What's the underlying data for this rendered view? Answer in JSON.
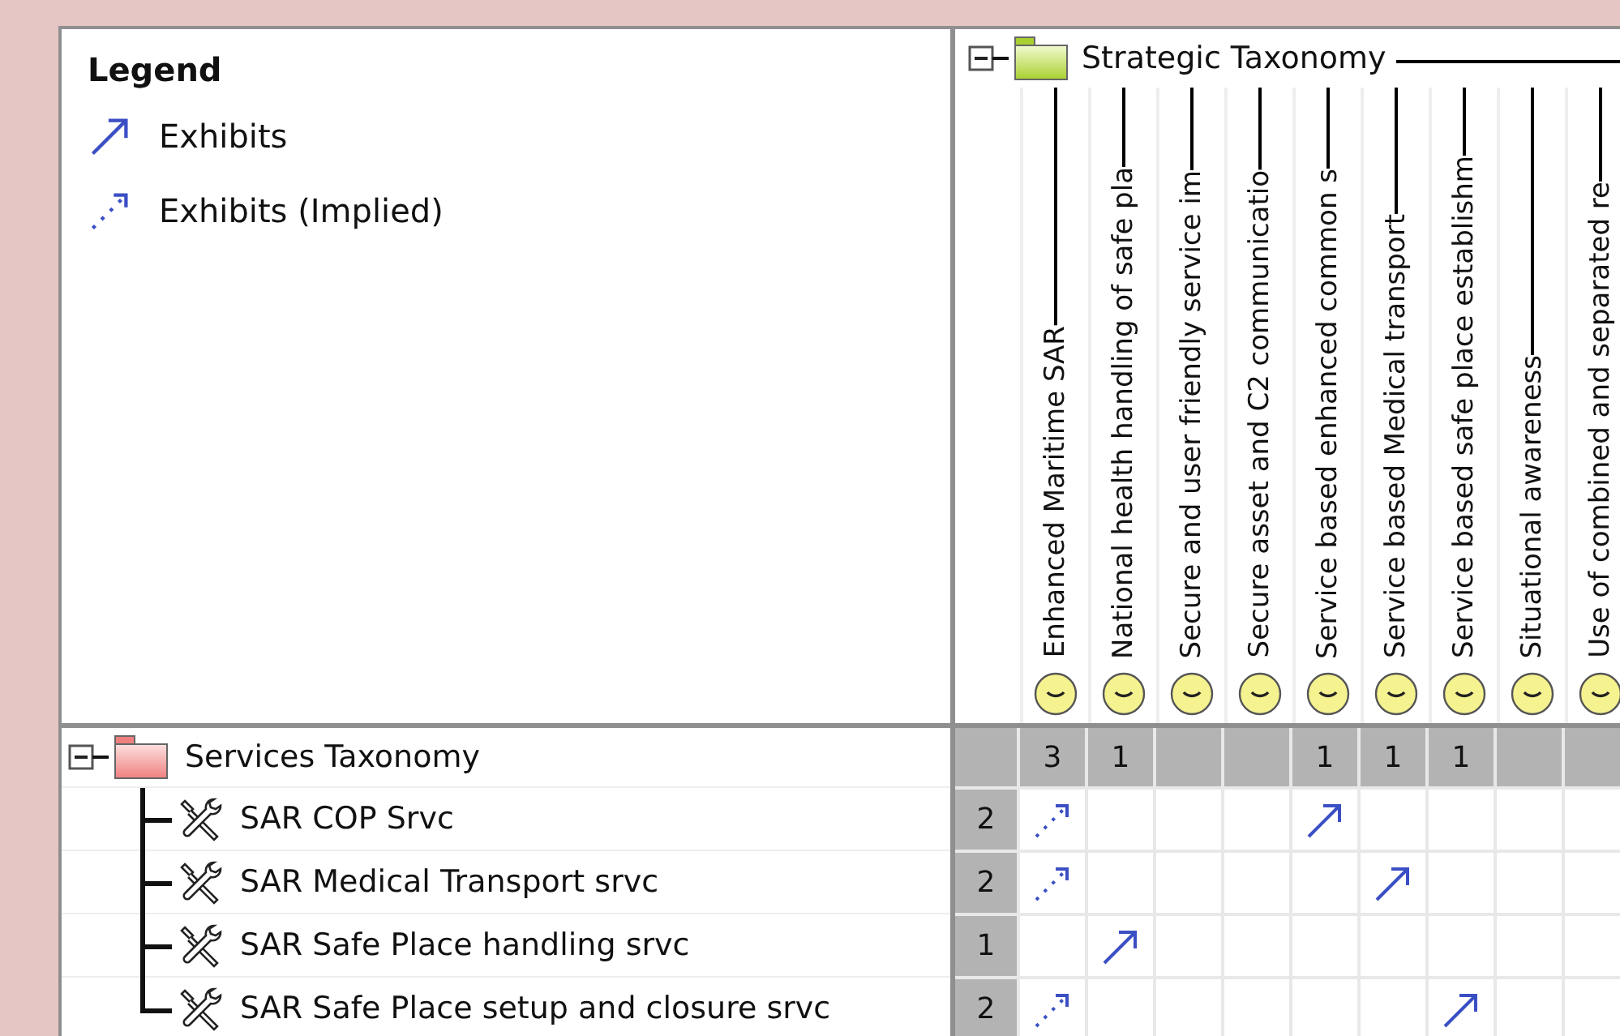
{
  "legend": {
    "title": "Legend",
    "items": [
      {
        "kind": "exhibits",
        "label": "Exhibits"
      },
      {
        "kind": "implied",
        "label": "Exhibits (Implied)"
      }
    ]
  },
  "column_root": {
    "label": "Strategic Taxonomy",
    "expanded": true
  },
  "columns": [
    {
      "label": "Enhanced Maritime SAR",
      "count": "3"
    },
    {
      "label": "National health handling of safe pla",
      "count": "1"
    },
    {
      "label": "Secure and user friendly service im"
    },
    {
      "label": "Secure asset and C2 communicatio"
    },
    {
      "label": "Service based enhanced common s",
      "count": "1"
    },
    {
      "label": "Service based Medical transport",
      "count": "1"
    },
    {
      "label": "Service based safe place establishm",
      "count": "1"
    },
    {
      "label": "Situational awareness"
    },
    {
      "label": "Use of combined and separated re"
    }
  ],
  "row_root": {
    "label": "Services Taxonomy",
    "expanded": true
  },
  "rows": [
    {
      "label": "SAR COP Srvc",
      "count": "2",
      "cells": [
        {
          "kind": "implied"
        },
        {
          "kind": "empty"
        },
        {
          "kind": "empty"
        },
        {
          "kind": "empty"
        },
        {
          "kind": "exhibits"
        },
        {
          "kind": "empty"
        },
        {
          "kind": "empty"
        },
        {
          "kind": "empty"
        },
        {
          "kind": "empty"
        }
      ]
    },
    {
      "label": "SAR Medical Transport srvc",
      "count": "2",
      "cells": [
        {
          "kind": "implied"
        },
        {
          "kind": "empty"
        },
        {
          "kind": "empty"
        },
        {
          "kind": "empty"
        },
        {
          "kind": "empty"
        },
        {
          "kind": "exhibits"
        },
        {
          "kind": "empty"
        },
        {
          "kind": "empty"
        },
        {
          "kind": "empty"
        }
      ]
    },
    {
      "label": "SAR Safe Place handling srvc",
      "count": "1",
      "cells": [
        {
          "kind": "empty"
        },
        {
          "kind": "exhibits"
        },
        {
          "kind": "empty"
        },
        {
          "kind": "empty"
        },
        {
          "kind": "empty"
        },
        {
          "kind": "empty"
        },
        {
          "kind": "empty"
        },
        {
          "kind": "empty"
        },
        {
          "kind": "empty"
        }
      ]
    },
    {
      "label": "SAR Safe Place setup and closure srvc",
      "count": "2",
      "cells": [
        {
          "kind": "implied"
        },
        {
          "kind": "empty"
        },
        {
          "kind": "empty"
        },
        {
          "kind": "empty"
        },
        {
          "kind": "empty"
        },
        {
          "kind": "empty"
        },
        {
          "kind": "exhibits"
        },
        {
          "kind": "empty"
        },
        {
          "kind": "empty"
        }
      ]
    }
  ]
}
